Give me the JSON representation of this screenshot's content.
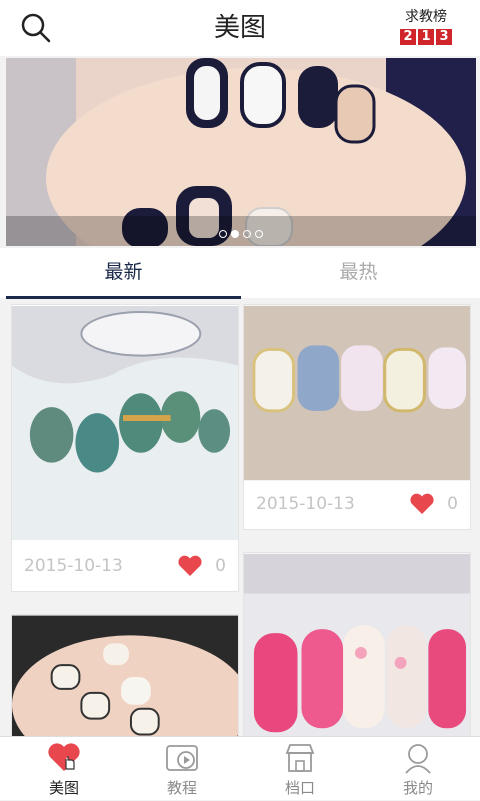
{
  "header": {
    "title": "美图",
    "rank_label": "求教榜",
    "rank_digits": [
      "2",
      "1",
      "3"
    ]
  },
  "banner": {
    "slide_count": 4,
    "active_slide": 2
  },
  "tabs": [
    {
      "label": "最新",
      "active": true
    },
    {
      "label": "最热",
      "active": false
    }
  ],
  "feed": [
    {
      "date": "2015-10-13",
      "likes": "0"
    },
    {
      "date": "2015-10-13",
      "likes": "0"
    }
  ],
  "bottom_nav": [
    {
      "label": "美图",
      "icon": "heart-icon",
      "active": true
    },
    {
      "label": "教程",
      "icon": "video-icon",
      "active": false
    },
    {
      "label": "档口",
      "icon": "shop-icon",
      "active": false
    },
    {
      "label": "我的",
      "icon": "user-icon",
      "active": false
    }
  ],
  "colors": {
    "accent": "#e8474e",
    "nav_dark": "#1b2a4a",
    "rank_red": "#d0262b"
  }
}
